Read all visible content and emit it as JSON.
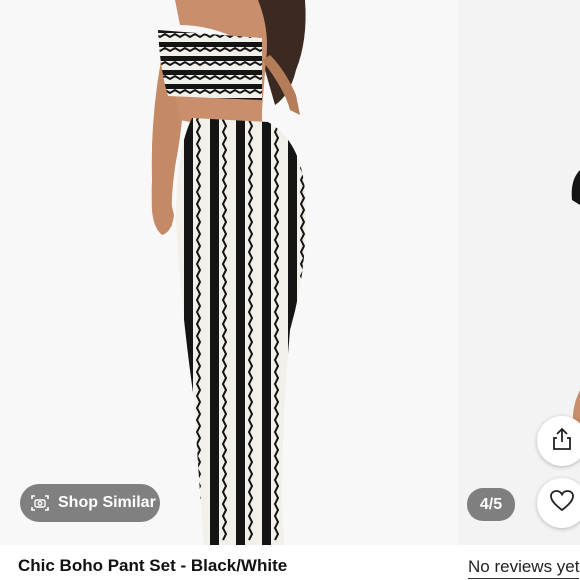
{
  "product": {
    "title": "Chic Boho Pant Set - Black/White",
    "reviews_text": "No reviews yet"
  },
  "gallery": {
    "shop_similar_label": "Shop Similar",
    "counter": "4/5"
  },
  "icons": {
    "shop_similar": "camera-scan-icon",
    "share": "share-icon",
    "like": "heart-icon"
  },
  "colors": {
    "pill_bg": "#6e6e6e",
    "pattern_dark": "#141414",
    "pattern_light": "#f2f0ea"
  }
}
